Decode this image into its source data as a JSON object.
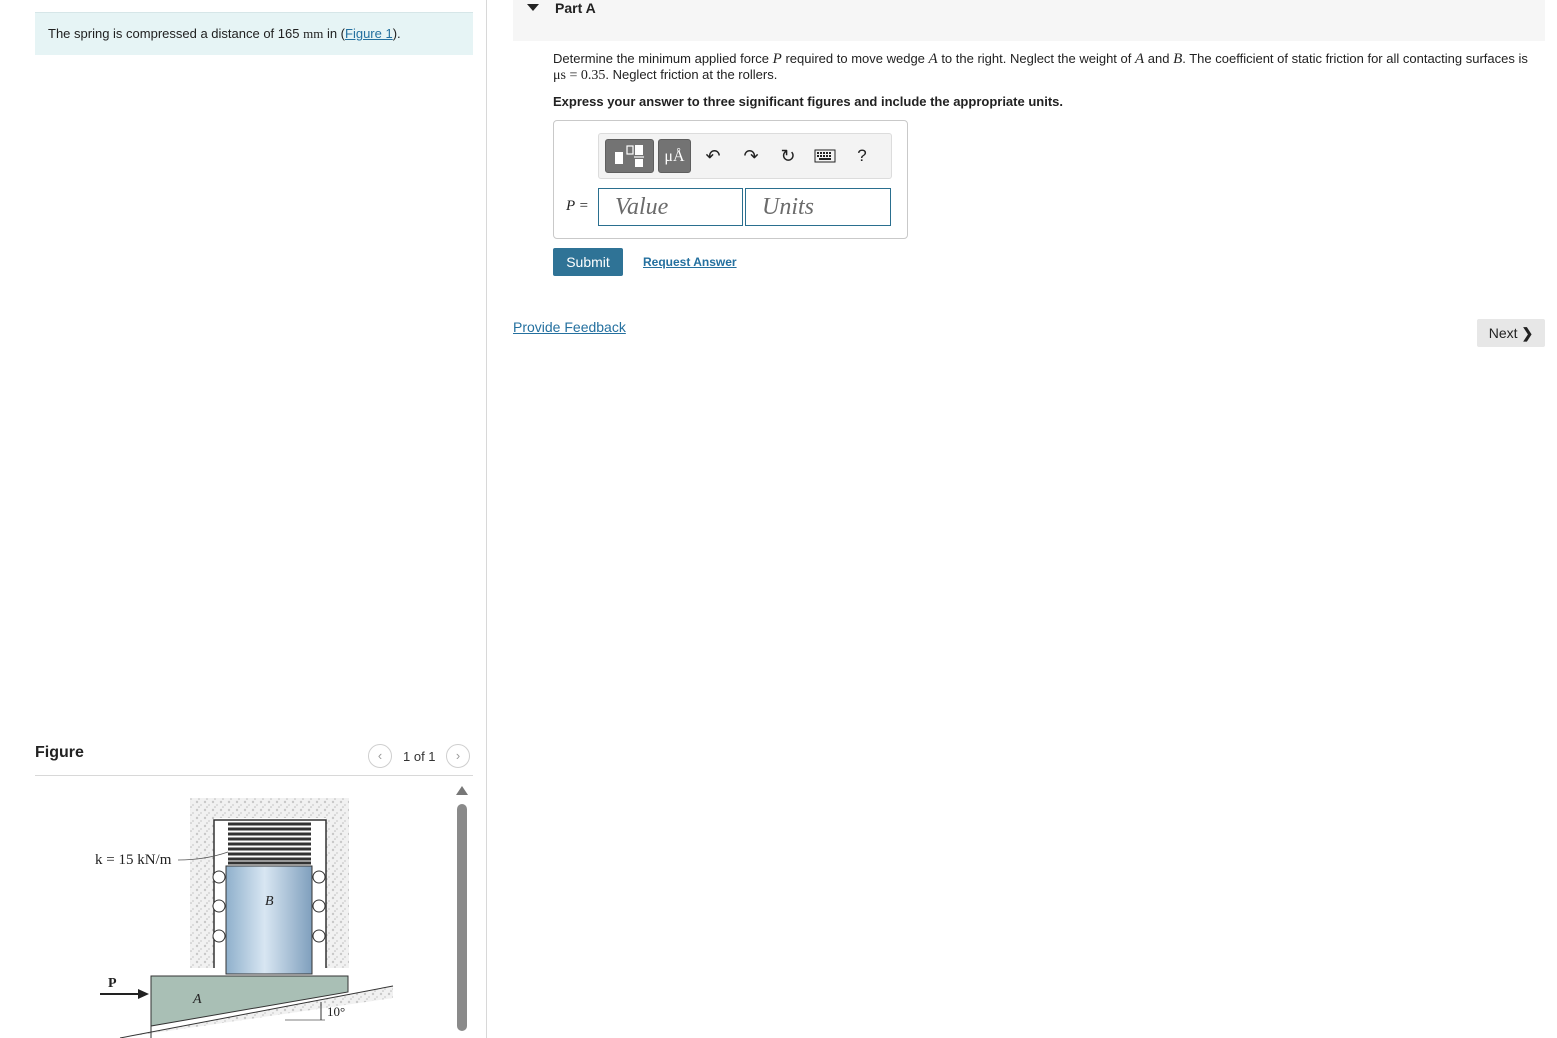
{
  "intro": {
    "prefix": "The spring is compressed a distance of ",
    "value": "165",
    "unit": "mm",
    "middle": " in (",
    "link": "Figure 1",
    "suffix": ")."
  },
  "figure": {
    "title": "Figure",
    "pager": {
      "prev_icon": "chevron-left-icon",
      "count": "1 of 1",
      "next_icon": "chevron-right-icon"
    },
    "labels": {
      "spring": "k = 15 kN/m",
      "block_b": "B",
      "wedge_a": "A",
      "force": "P",
      "angle": "10°"
    }
  },
  "part": {
    "title": "Part A",
    "question": {
      "t1": "Determine the minimum applied force ",
      "v1": "P",
      "t2": " required to move wedge ",
      "v2": "A",
      "t3": " to the right. Neglect the weight of ",
      "v3": "A",
      "t4": " and ",
      "v4": "B",
      "t5": ". The coefficient of static friction for all contacting surfaces is",
      "mu": "μs = 0.35",
      "t6": ". Neglect friction at the rollers."
    },
    "instruction": "Express your answer to three significant figures and include the appropriate units."
  },
  "toolbar": {
    "units_label": "μÅ",
    "undo_icon": "undo-icon",
    "redo_icon": "redo-icon",
    "reset_icon": "reset-icon",
    "keyboard_icon": "keyboard-icon",
    "help_label": "?"
  },
  "answer": {
    "label": "P =",
    "value_placeholder": "Value",
    "units_placeholder": "Units"
  },
  "actions": {
    "submit": "Submit",
    "request_answer": "Request Answer",
    "provide_feedback": "Provide Feedback",
    "next": "Next"
  },
  "colors": {
    "accent": "#2f7396",
    "link": "#24709f",
    "intro_bg": "#e6f4f5"
  }
}
